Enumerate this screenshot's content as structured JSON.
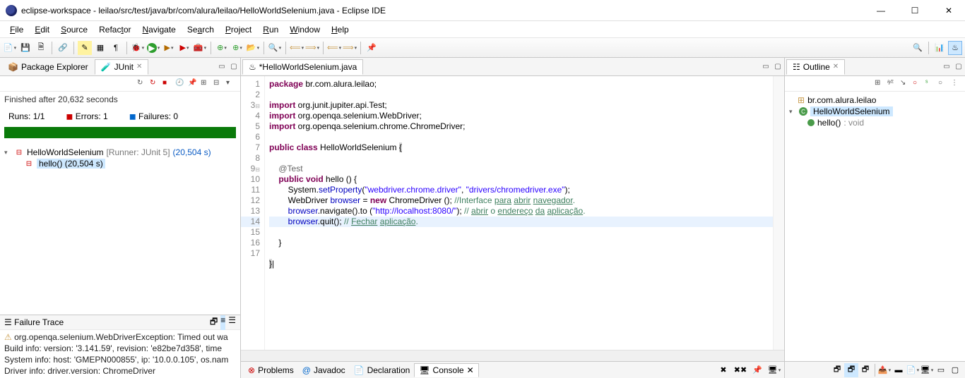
{
  "window": {
    "title": "eclipse-workspace - leilao/src/test/java/br/com/alura/leilao/HelloWorldSelenium.java - Eclipse IDE"
  },
  "menu": {
    "file": "File",
    "edit": "Edit",
    "source": "Source",
    "refactor": "Refactor",
    "navigate": "Navigate",
    "search": "Search",
    "project": "Project",
    "run": "Run",
    "window": "Window",
    "help": "Help"
  },
  "left": {
    "pkg_explorer": "Package Explorer",
    "junit": "JUnit",
    "finished": "Finished after 20,632 seconds",
    "runs_l": "Runs:",
    "runs_v": "1/1",
    "err_l": "Errors:",
    "err_v": "1",
    "fail_l": "Failures:",
    "fail_v": "0",
    "root": "HelloWorldSelenium",
    "runner": "[Runner: JUnit 5]",
    "root_t": "(20,504 s)",
    "child": "hello()",
    "child_t": "(20,504 s)",
    "ft_title": "Failure Trace",
    "ft1": "org.openqa.selenium.WebDriverException: Timed out wa",
    "ft2": "Build info: version: '3.141.59', revision: 'e82be7d358', time",
    "ft3": "System info: host: 'GMEPN000855', ip: '10.0.0.105', os.nam",
    "ft4": "Driver info: driver.version: ChromeDriver"
  },
  "editor": {
    "tab": "*HelloWorldSelenium.java",
    "lines": [
      "1",
      "2",
      "3",
      "4",
      "5",
      "6",
      "7",
      "8",
      "9",
      "10",
      "11",
      "12",
      "13",
      "14",
      "15",
      "16",
      "17"
    ]
  },
  "bottom": {
    "problems": "Problems",
    "javadoc": "Javadoc",
    "declaration": "Declaration",
    "console": "Console"
  },
  "outline": {
    "title": "Outline",
    "pkg": "br.com.alura.leilao",
    "cls": "HelloWorldSelenium",
    "mth": "hello()",
    "ret": ": void"
  },
  "chart_data": null
}
